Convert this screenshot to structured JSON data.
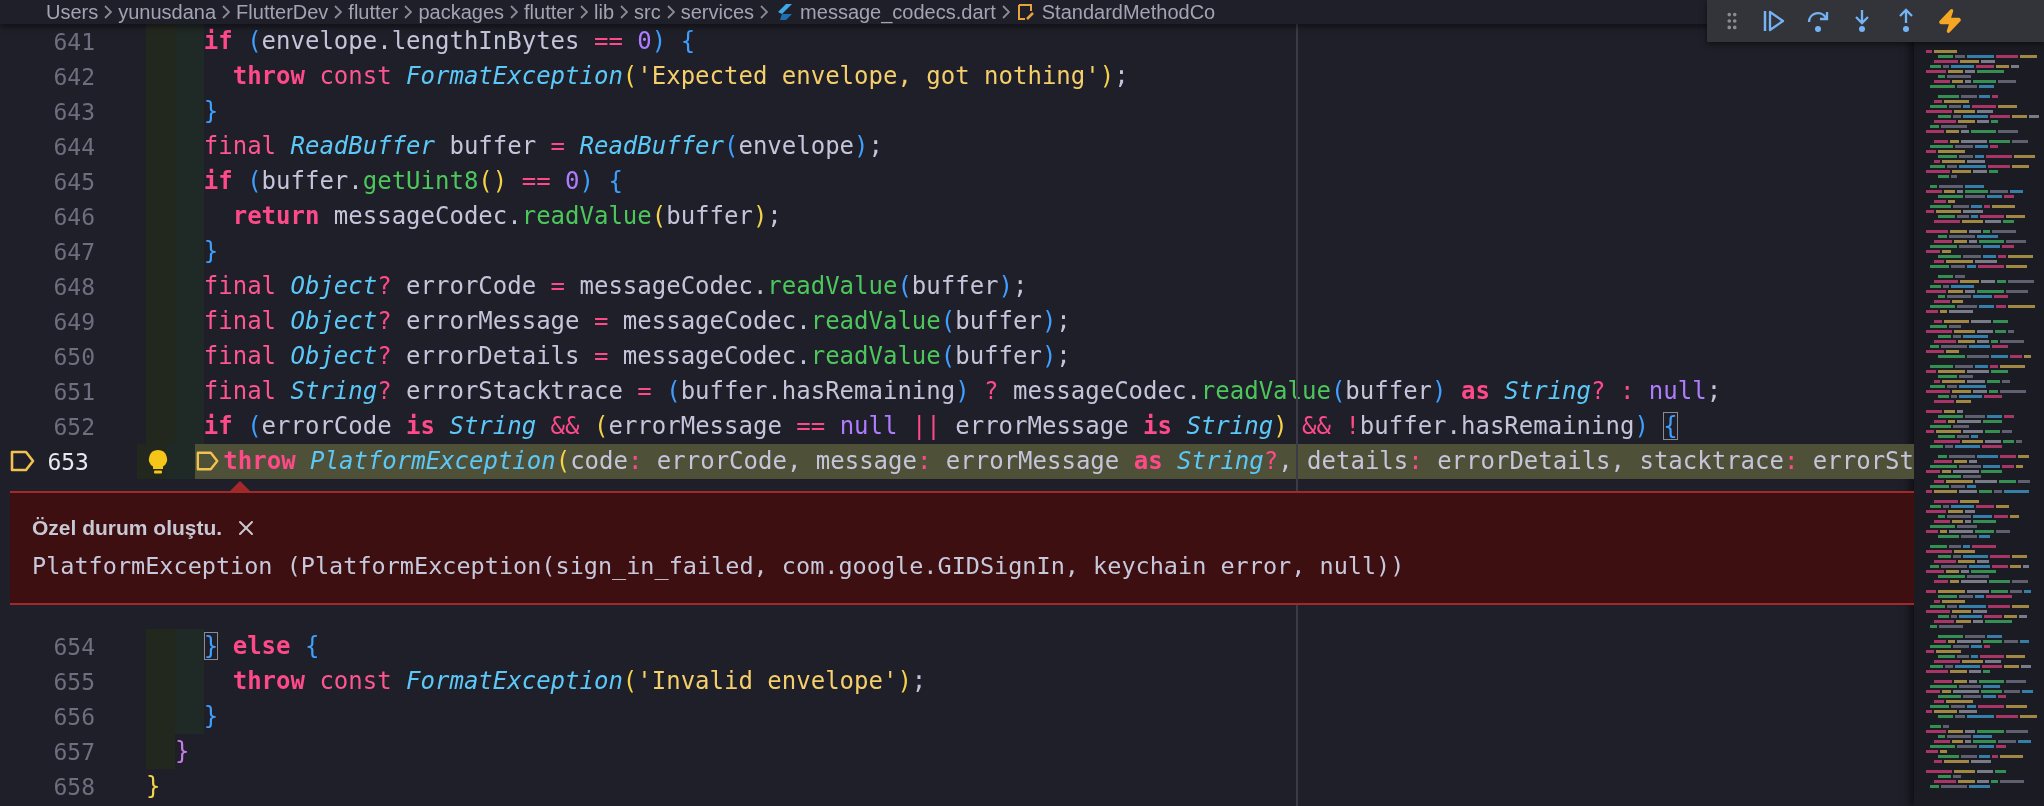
{
  "breadcrumb": [
    {
      "label": "Users",
      "kind": "folder"
    },
    {
      "label": "yunusdana",
      "kind": "folder"
    },
    {
      "label": "FlutterDev",
      "kind": "folder"
    },
    {
      "label": "flutter",
      "kind": "folder"
    },
    {
      "label": "packages",
      "kind": "folder"
    },
    {
      "label": "flutter",
      "kind": "folder"
    },
    {
      "label": "lib",
      "kind": "folder"
    },
    {
      "label": "src",
      "kind": "folder"
    },
    {
      "label": "services",
      "kind": "folder"
    },
    {
      "label": "message_codecs.dart",
      "kind": "file"
    },
    {
      "label": "StandardMethodCo",
      "kind": "symbol"
    }
  ],
  "editor": {
    "lines": [
      {
        "number": "641",
        "paused": false,
        "tokens": [
          {
            "t": "    if",
            "kind": "kw"
          },
          {
            "t": " (",
            "kind": "br3"
          },
          {
            "t": "envelope.lengthInBytes ",
            "kind": "plain"
          },
          {
            "t": "==",
            "kind": "op"
          },
          {
            "t": " 0",
            "kind": "num"
          },
          {
            "t": ")",
            "kind": "br3"
          },
          {
            "t": " {",
            "kind": "br3"
          }
        ]
      },
      {
        "number": "642",
        "paused": false,
        "tokens": [
          {
            "t": "      throw",
            "kind": "kw"
          },
          {
            "t": " const",
            "kind": "mod"
          },
          {
            "t": " FormatException",
            "kind": "type"
          },
          {
            "t": "(",
            "kind": "br1"
          },
          {
            "t": "'Expected envelope, got nothing'",
            "kind": "str"
          },
          {
            "t": ")",
            "kind": "br1"
          },
          {
            "t": ";",
            "kind": "plain"
          }
        ]
      },
      {
        "number": "643",
        "paused": false,
        "tokens": [
          {
            "t": "    }",
            "kind": "br3"
          }
        ]
      },
      {
        "number": "644",
        "paused": false,
        "tokens": [
          {
            "t": "    final",
            "kind": "mod"
          },
          {
            "t": " ReadBuffer",
            "kind": "type"
          },
          {
            "t": " buffer ",
            "kind": "plain"
          },
          {
            "t": "=",
            "kind": "op"
          },
          {
            "t": " ReadBuffer",
            "kind": "type"
          },
          {
            "t": "(",
            "kind": "br3"
          },
          {
            "t": "envelope",
            "kind": "plain"
          },
          {
            "t": ")",
            "kind": "br3"
          },
          {
            "t": ";",
            "kind": "plain"
          }
        ]
      },
      {
        "number": "645",
        "paused": false,
        "tokens": [
          {
            "t": "    if",
            "kind": "kw"
          },
          {
            "t": " (",
            "kind": "br3"
          },
          {
            "t": "buffer.",
            "kind": "plain"
          },
          {
            "t": "getUint8",
            "kind": "fn"
          },
          {
            "t": "()",
            "kind": "br1"
          },
          {
            "t": " ==",
            "kind": "op"
          },
          {
            "t": " 0",
            "kind": "num"
          },
          {
            "t": ")",
            "kind": "br3"
          },
          {
            "t": " {",
            "kind": "br3"
          }
        ]
      },
      {
        "number": "646",
        "paused": false,
        "tokens": [
          {
            "t": "      return",
            "kind": "kw"
          },
          {
            "t": " messageCodec.",
            "kind": "plain"
          },
          {
            "t": "readValue",
            "kind": "fn"
          },
          {
            "t": "(",
            "kind": "br1"
          },
          {
            "t": "buffer",
            "kind": "plain"
          },
          {
            "t": ")",
            "kind": "br1"
          },
          {
            "t": ";",
            "kind": "plain"
          }
        ]
      },
      {
        "number": "647",
        "paused": false,
        "tokens": [
          {
            "t": "    }",
            "kind": "br3"
          }
        ]
      },
      {
        "number": "648",
        "paused": false,
        "tokens": [
          {
            "t": "    final",
            "kind": "mod"
          },
          {
            "t": " Object",
            "kind": "type"
          },
          {
            "t": "?",
            "kind": "op"
          },
          {
            "t": " errorCode ",
            "kind": "plain"
          },
          {
            "t": "=",
            "kind": "op"
          },
          {
            "t": " messageCodec.",
            "kind": "plain"
          },
          {
            "t": "readValue",
            "kind": "fn"
          },
          {
            "t": "(",
            "kind": "br3"
          },
          {
            "t": "buffer",
            "kind": "plain"
          },
          {
            "t": ")",
            "kind": "br3"
          },
          {
            "t": ";",
            "kind": "plain"
          }
        ]
      },
      {
        "number": "649",
        "paused": false,
        "tokens": [
          {
            "t": "    final",
            "kind": "mod"
          },
          {
            "t": " Object",
            "kind": "type"
          },
          {
            "t": "?",
            "kind": "op"
          },
          {
            "t": " errorMessage ",
            "kind": "plain"
          },
          {
            "t": "=",
            "kind": "op"
          },
          {
            "t": " messageCodec.",
            "kind": "plain"
          },
          {
            "t": "readValue",
            "kind": "fn"
          },
          {
            "t": "(",
            "kind": "br3"
          },
          {
            "t": "buffer",
            "kind": "plain"
          },
          {
            "t": ")",
            "kind": "br3"
          },
          {
            "t": ";",
            "kind": "plain"
          }
        ]
      },
      {
        "number": "650",
        "paused": false,
        "tokens": [
          {
            "t": "    final",
            "kind": "mod"
          },
          {
            "t": " Object",
            "kind": "type"
          },
          {
            "t": "?",
            "kind": "op"
          },
          {
            "t": " errorDetails ",
            "kind": "plain"
          },
          {
            "t": "=",
            "kind": "op"
          },
          {
            "t": " messageCodec.",
            "kind": "plain"
          },
          {
            "t": "readValue",
            "kind": "fn"
          },
          {
            "t": "(",
            "kind": "br3"
          },
          {
            "t": "buffer",
            "kind": "plain"
          },
          {
            "t": ")",
            "kind": "br3"
          },
          {
            "t": ";",
            "kind": "plain"
          }
        ]
      },
      {
        "number": "651",
        "paused": false,
        "tokens": [
          {
            "t": "    final",
            "kind": "mod"
          },
          {
            "t": " String",
            "kind": "type"
          },
          {
            "t": "?",
            "kind": "op"
          },
          {
            "t": " errorStacktrace ",
            "kind": "plain"
          },
          {
            "t": "=",
            "kind": "op"
          },
          {
            "t": " (",
            "kind": "br3"
          },
          {
            "t": "buffer.hasRemaining",
            "kind": "plain"
          },
          {
            "t": ")",
            "kind": "br3"
          },
          {
            "t": " ?",
            "kind": "op"
          },
          {
            "t": " messageCodec.",
            "kind": "plain"
          },
          {
            "t": "readValue",
            "kind": "fn"
          },
          {
            "t": "(",
            "kind": "br3"
          },
          {
            "t": "buffer",
            "kind": "plain"
          },
          {
            "t": ")",
            "kind": "br3"
          },
          {
            "t": " as",
            "kind": "kw"
          },
          {
            "t": " String",
            "kind": "type"
          },
          {
            "t": "?",
            "kind": "op"
          },
          {
            "t": " :",
            "kind": "op"
          },
          {
            "t": " null",
            "kind": "num"
          },
          {
            "t": ";",
            "kind": "plain"
          }
        ]
      },
      {
        "number": "652",
        "paused": false,
        "tokens": [
          {
            "t": "    if",
            "kind": "kw"
          },
          {
            "t": " (",
            "kind": "br3"
          },
          {
            "t": "errorCode ",
            "kind": "plain"
          },
          {
            "t": "is",
            "kind": "kw"
          },
          {
            "t": " String",
            "kind": "type"
          },
          {
            "t": " &&",
            "kind": "op"
          },
          {
            "t": " (",
            "kind": "br1"
          },
          {
            "t": "errorMessage ",
            "kind": "plain"
          },
          {
            "t": "==",
            "kind": "op"
          },
          {
            "t": " null",
            "kind": "num"
          },
          {
            "t": " ||",
            "kind": "op"
          },
          {
            "t": " errorMessage ",
            "kind": "plain"
          },
          {
            "t": "is",
            "kind": "kw"
          },
          {
            "t": " String",
            "kind": "type"
          },
          {
            "t": ")",
            "kind": "br1"
          },
          {
            "t": " && !",
            "kind": "op"
          },
          {
            "t": "buffer.hasRemaining",
            "kind": "plain"
          },
          {
            "t": ") ",
            "kind": "br3"
          },
          {
            "t": "{",
            "kind": "match"
          }
        ]
      },
      {
        "number": "653",
        "paused": true,
        "tokens": [
          {
            "t": "      throw",
            "kind": "kw"
          },
          {
            "t": " PlatformException",
            "kind": "type"
          },
          {
            "t": "(",
            "kind": "br1"
          },
          {
            "t": "code",
            "kind": "plain"
          },
          {
            "t": ":",
            "kind": "op"
          },
          {
            "t": " errorCode, message",
            "kind": "plain"
          },
          {
            "t": ":",
            "kind": "op"
          },
          {
            "t": " errorMessage ",
            "kind": "plain"
          },
          {
            "t": "as",
            "kind": "kw"
          },
          {
            "t": " String",
            "kind": "type"
          },
          {
            "t": "?",
            "kind": "op"
          },
          {
            "t": ", details",
            "kind": "plain"
          },
          {
            "t": ":",
            "kind": "op"
          },
          {
            "t": " errorDetails, stacktrace",
            "kind": "plain"
          },
          {
            "t": ":",
            "kind": "op"
          },
          {
            "t": " errorSt",
            "kind": "plain"
          }
        ]
      },
      {
        "number": "654",
        "paused": false,
        "tokens": [
          {
            "t": "    }",
            "kind": "match"
          },
          {
            "t": " else",
            "kind": "kw"
          },
          {
            "t": " {",
            "kind": "br3"
          }
        ]
      },
      {
        "number": "655",
        "paused": false,
        "tokens": [
          {
            "t": "      throw",
            "kind": "kw"
          },
          {
            "t": " const",
            "kind": "mod"
          },
          {
            "t": " FormatException",
            "kind": "type"
          },
          {
            "t": "(",
            "kind": "br1"
          },
          {
            "t": "'Invalid envelope'",
            "kind": "str"
          },
          {
            "t": ")",
            "kind": "br1"
          },
          {
            "t": ";",
            "kind": "plain"
          }
        ]
      },
      {
        "number": "656",
        "paused": false,
        "tokens": [
          {
            "t": "    }",
            "kind": "br3"
          }
        ]
      },
      {
        "number": "657",
        "paused": false,
        "tokens": [
          {
            "t": "  }",
            "kind": "br2"
          }
        ]
      },
      {
        "number": "658",
        "paused": false,
        "tokens": [
          {
            "t": "}",
            "kind": "br1"
          }
        ]
      }
    ]
  },
  "exception": {
    "title": "Özel durum oluştu.",
    "message": "PlatformException (PlatformException(sign_in_failed, com.google.GIDSignIn, keychain error, null))"
  }
}
